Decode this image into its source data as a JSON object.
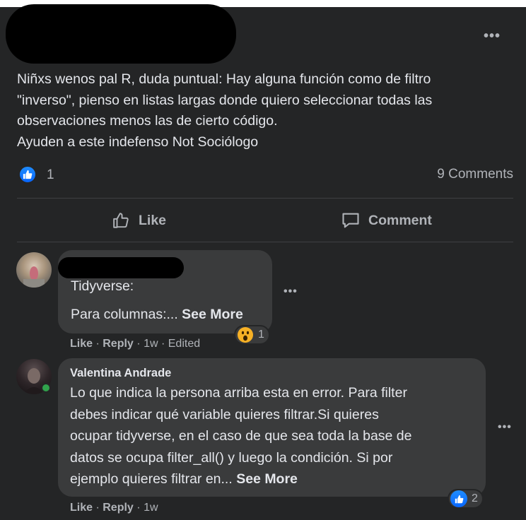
{
  "post": {
    "author_redacted": true,
    "body_lines": [
      "Niñxs wenos pal R, duda puntual: Hay alguna función como de filtro",
      "\"inverso\", pienso en listas largas donde quiero seleccionar todas las",
      "observaciones menos las de cierto código.",
      "Ayuden a este indefenso Not Sociólogo"
    ],
    "reaction_count": "1",
    "comments_count": "9 Comments",
    "actions": {
      "like": "Like",
      "comment": "Comment"
    }
  },
  "comments": [
    {
      "author_redacted": true,
      "line1": "Tidyverse:",
      "line2": "Para columnas:...",
      "see_more": "See More",
      "reaction_count": "1",
      "reaction_icon": "wow-emoji-icon",
      "meta": {
        "like": "Like",
        "reply": "Reply",
        "time": "1w",
        "edited": "Edited"
      }
    },
    {
      "author": "Valentina Andrade",
      "lines": [
        "Lo que indica la persona arriba esta en error. Para filter",
        "debes indicar qué variable quieres filtrar.Si quieres",
        "ocupar tidyverse, en el caso de que sea toda la base de",
        "datos se ocupa filter_all() y luego la condición. Si por",
        "ejemplo quieres filtrar en..."
      ],
      "see_more": "See More",
      "reaction_count": "2",
      "reaction_icon": "like-icon",
      "meta": {
        "like": "Like",
        "reply": "Reply",
        "time": "1w"
      }
    }
  ],
  "colors": {
    "background": "#242526",
    "bubble": "#3a3b3c",
    "text": "#e4e6eb",
    "secondary_text": "#b0b3b8",
    "like_blue": "#0866ff",
    "online_green": "#31a24c"
  }
}
